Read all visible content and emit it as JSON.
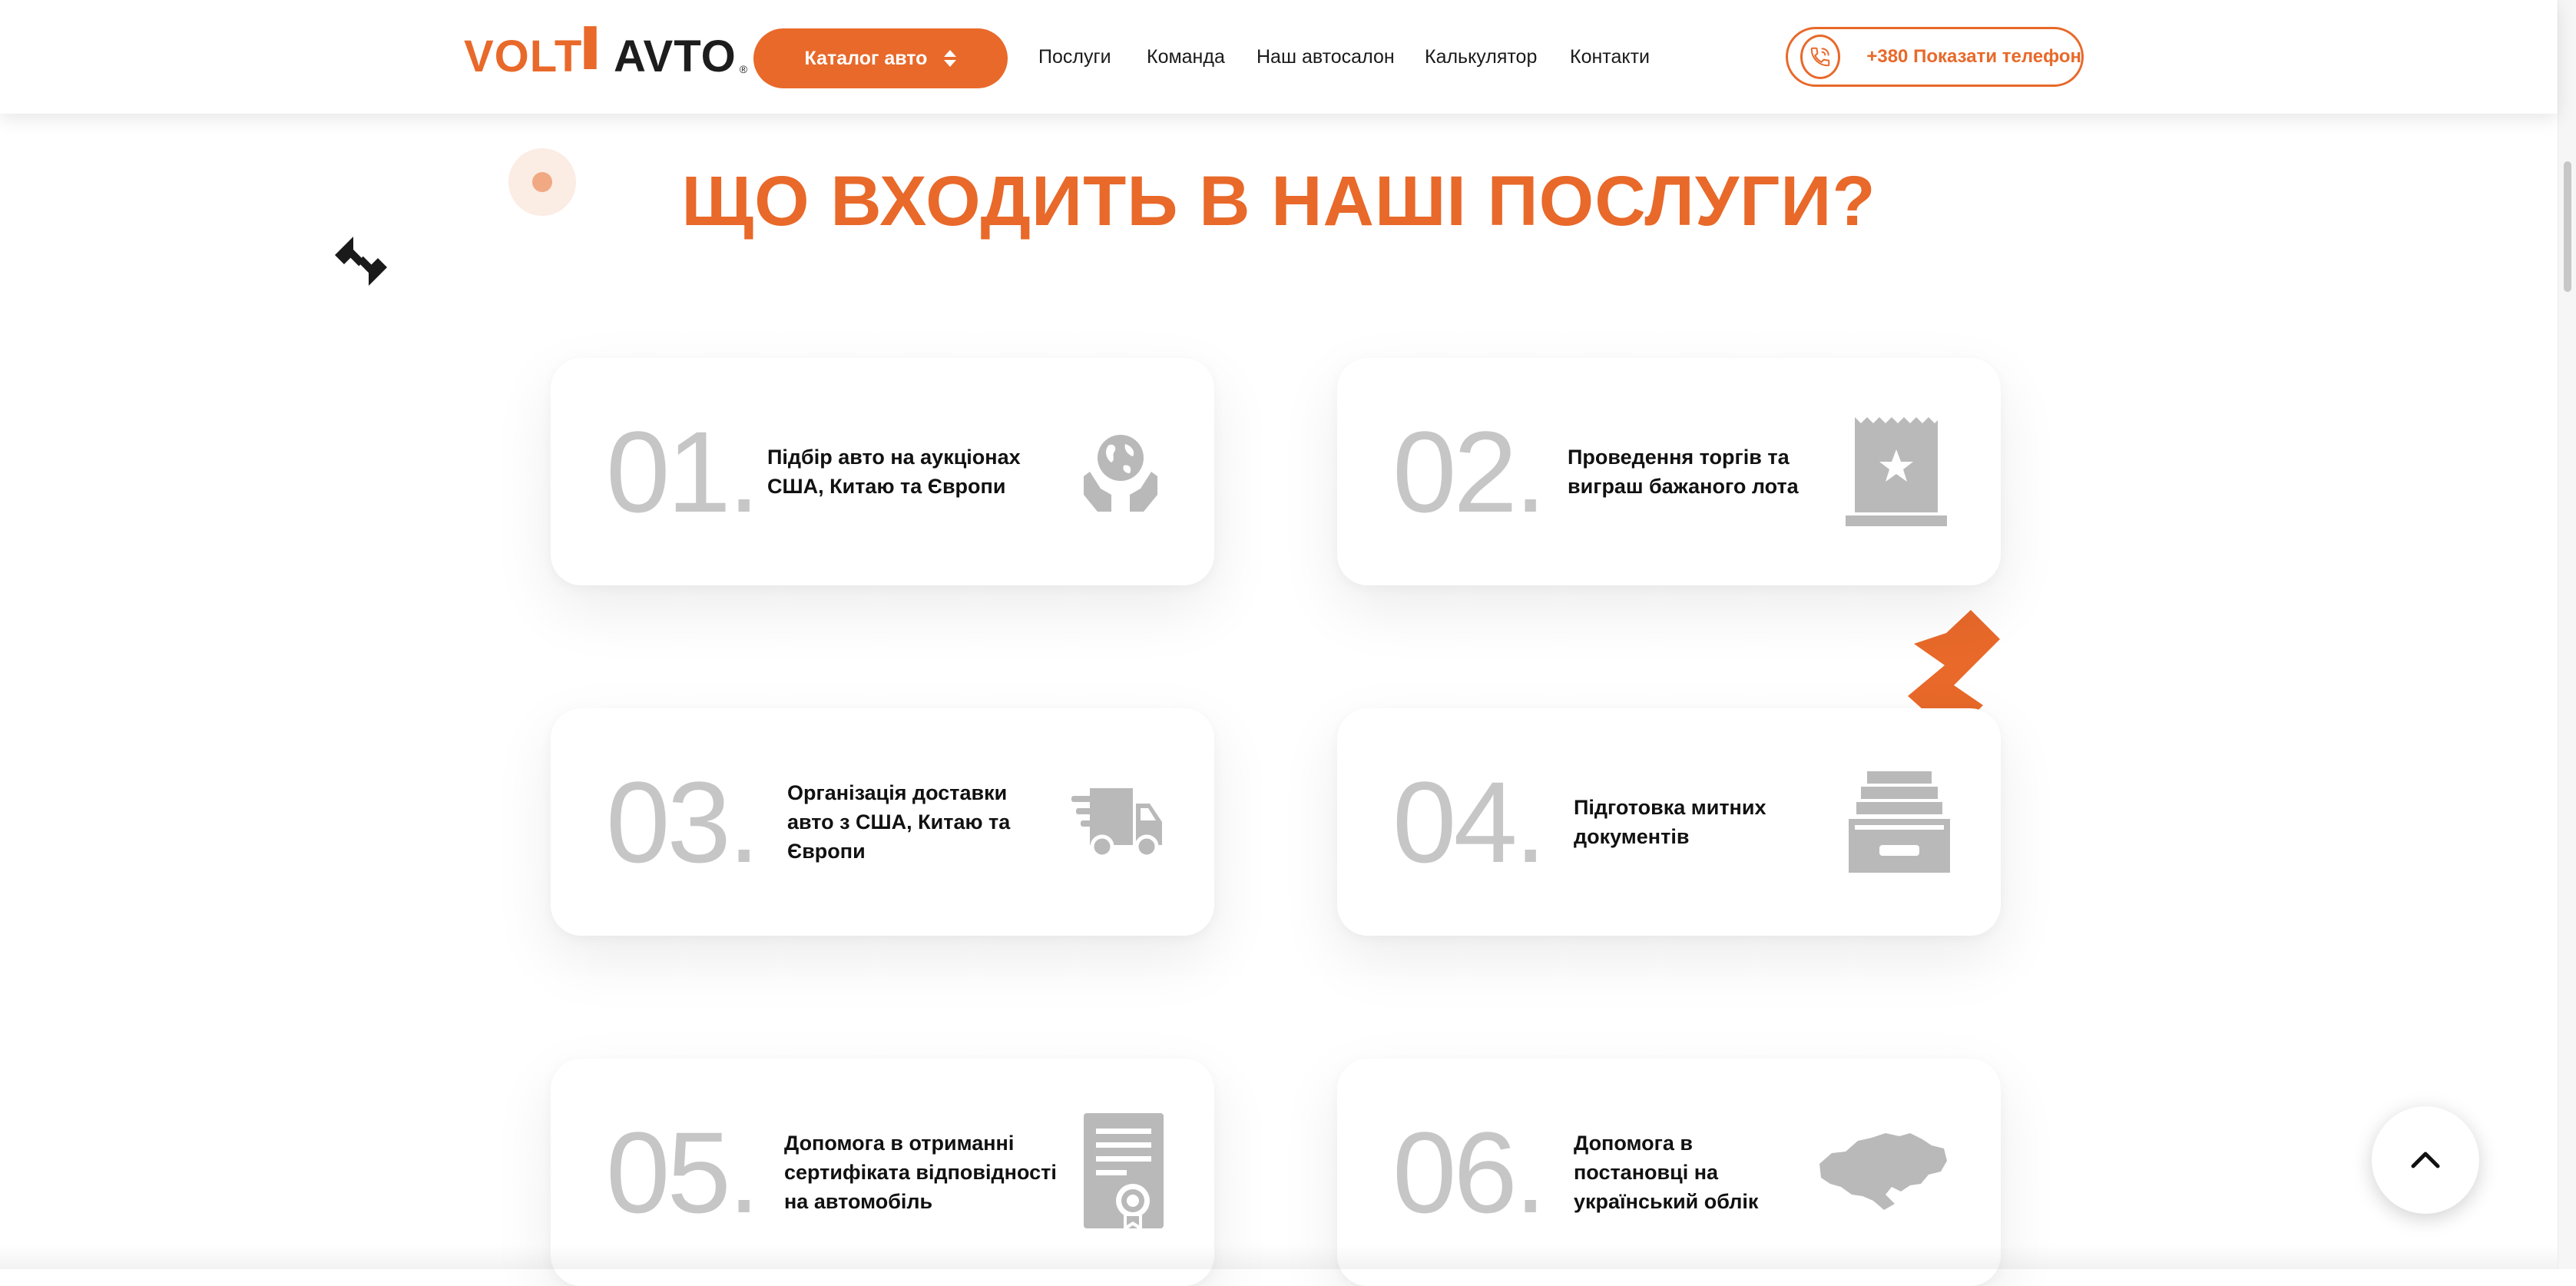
{
  "header": {
    "logo": {
      "volt": "VOLT",
      "avto": "AVTO",
      "reg": "®"
    },
    "catalog_label": "Каталог авто",
    "nav": [
      {
        "label": "Послуги"
      },
      {
        "label": "Команда"
      },
      {
        "label": "Наш автосалон"
      },
      {
        "label": "Калькулятор"
      },
      {
        "label": "Контакти"
      }
    ],
    "phone_label": "+380 Показати телефон"
  },
  "section": {
    "title": "ЩО ВХОДИТЬ В НАШІ ПОСЛУГИ?",
    "cards": [
      {
        "num": "01.",
        "text": [
          "Підбір авто на аукціонах",
          "США, Китаю та Європи"
        ],
        "icon": "globe-hands-icon"
      },
      {
        "num": "02.",
        "text": [
          "Проведення торгів та",
          "виграш бажаного лота"
        ],
        "icon": "award-certificate-icon"
      },
      {
        "num": "03.",
        "text": [
          "Організація доставки",
          "авто з США, Китаю та",
          "Європи"
        ],
        "icon": "delivery-truck-icon"
      },
      {
        "num": "04.",
        "text": [
          "Підготовка митних",
          "документів"
        ],
        "icon": "document-tray-icon"
      },
      {
        "num": "05.",
        "text": [
          "Допомога в отриманні",
          "сертифіката відповідності",
          "на автомобіль"
        ],
        "icon": "certificate-icon"
      },
      {
        "num": "06.",
        "text": [
          "Допомога в",
          "постановці на",
          "український облік"
        ],
        "icon": "ukraine-map-icon"
      }
    ]
  },
  "colors": {
    "accent": "#e8692a",
    "number": "#c6c6c6",
    "icon": "#b9b9b9"
  }
}
